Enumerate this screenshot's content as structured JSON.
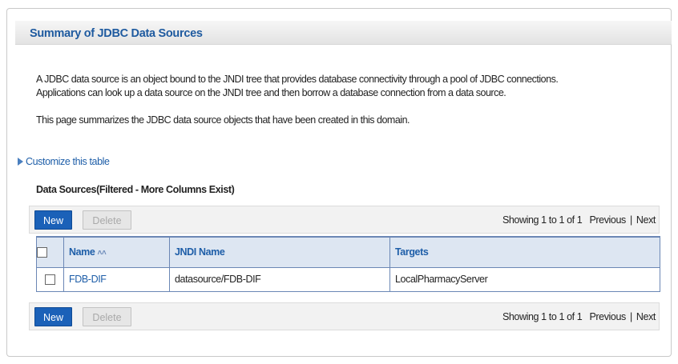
{
  "panel": {
    "title": "Summary of JDBC Data Sources",
    "intro_line1": "A JDBC data source is an object bound to the JNDI tree that provides database connectivity through a pool of JDBC connections.",
    "intro_line2": "Applications can look up a data source on the JNDI tree and then borrow a database connection from a data source.",
    "summary": "This page summarizes the JDBC data source objects that have been created in this domain.",
    "customize_link": "Customize this table"
  },
  "table_section": {
    "title": "Data Sources(Filtered - More Columns Exist)",
    "new_label": "New",
    "delete_label": "Delete",
    "showing": "Showing 1 to 1 of 1",
    "previous": "Previous",
    "separator": "|",
    "next": "Next",
    "columns": [
      "Name",
      "JNDI Name",
      "Targets"
    ],
    "rows": [
      {
        "name": "FDB-DIF",
        "jndi": "datasource/FDB-DIF",
        "targets": "LocalPharmacyServer"
      }
    ]
  },
  "icons": {
    "sort": "sort-ascending-icon",
    "customize": "triangle-right-icon"
  },
  "colors": {
    "accent": "#1e5ea8",
    "button": "#1b61b8",
    "header_row": "#dde6f2"
  }
}
